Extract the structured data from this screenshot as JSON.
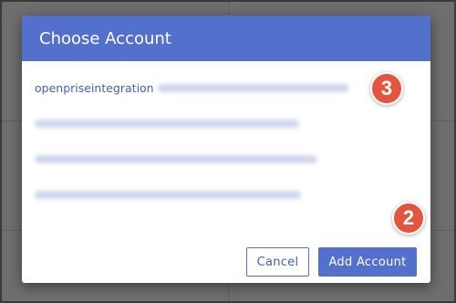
{
  "dialog": {
    "title": "Choose Account",
    "accounts": [
      {
        "label": "openpriseintegration"
      },
      {
        "label": ""
      },
      {
        "label": ""
      },
      {
        "label": ""
      }
    ],
    "cancel_label": "Cancel",
    "add_label": "Add Account"
  },
  "annotations": {
    "badge_account": "3",
    "badge_add": "2"
  },
  "colors": {
    "header": "#5371cc",
    "link": "#3f5fc0",
    "badge": "#e2553f"
  }
}
